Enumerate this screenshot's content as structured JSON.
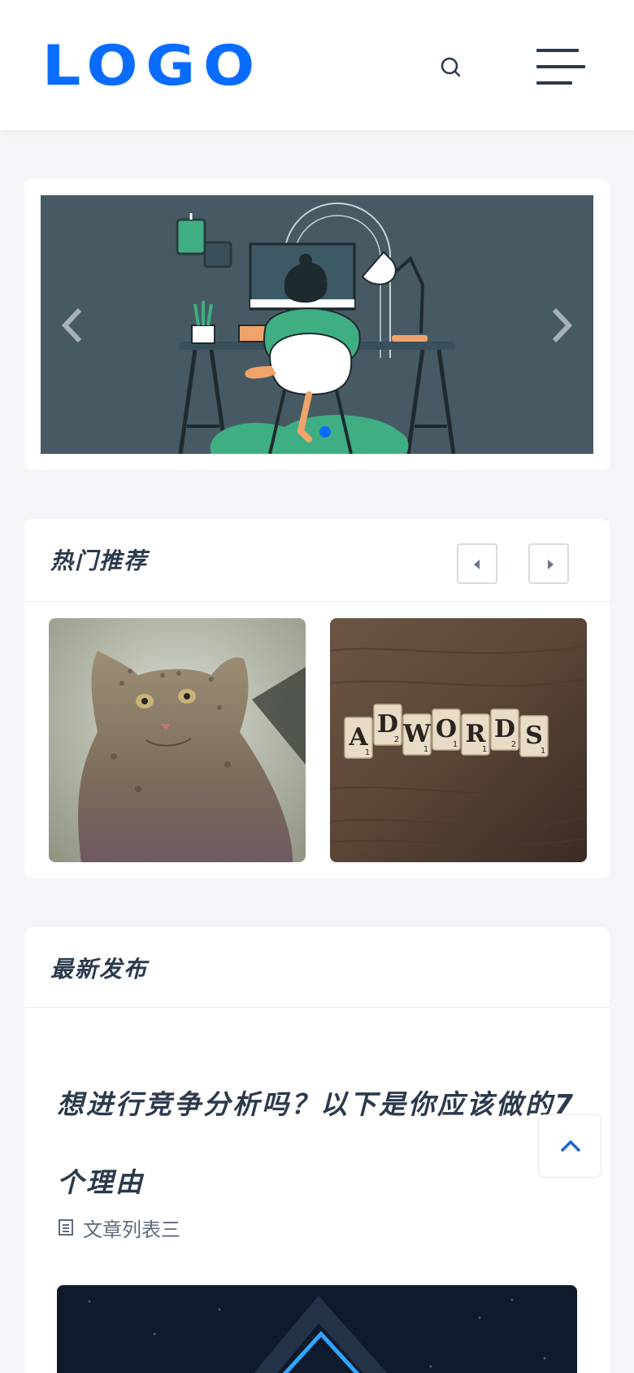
{
  "header": {
    "logo_text": "LOGO",
    "search_icon": "search-icon",
    "menu_icon": "hamburger-menu-icon"
  },
  "banner": {
    "prev_icon": "chevron-left-icon",
    "next_icon": "chevron-right-icon",
    "active_slide": 1
  },
  "hot": {
    "title": "热门推荐",
    "prev_icon": "caret-left-icon",
    "next_icon": "caret-right-icon",
    "thumb2_letters": [
      "A",
      "D",
      "W",
      "O",
      "R",
      "D",
      "S"
    ],
    "thumb2_subscripts": [
      "1",
      "2",
      "1",
      "1",
      "1",
      "2",
      "1"
    ]
  },
  "latest": {
    "title": "最新发布",
    "article_title": "想进行竞争分析吗？以下是你应该做的7个理由",
    "article_category": "文章列表三",
    "category_icon": "document-list-icon"
  },
  "back_to_top_icon": "chevron-up-icon",
  "colors": {
    "brand": "#0a6cff",
    "text": "#2b3a4d",
    "background": "#f3f5f9",
    "banner_bg": "#475a64"
  }
}
